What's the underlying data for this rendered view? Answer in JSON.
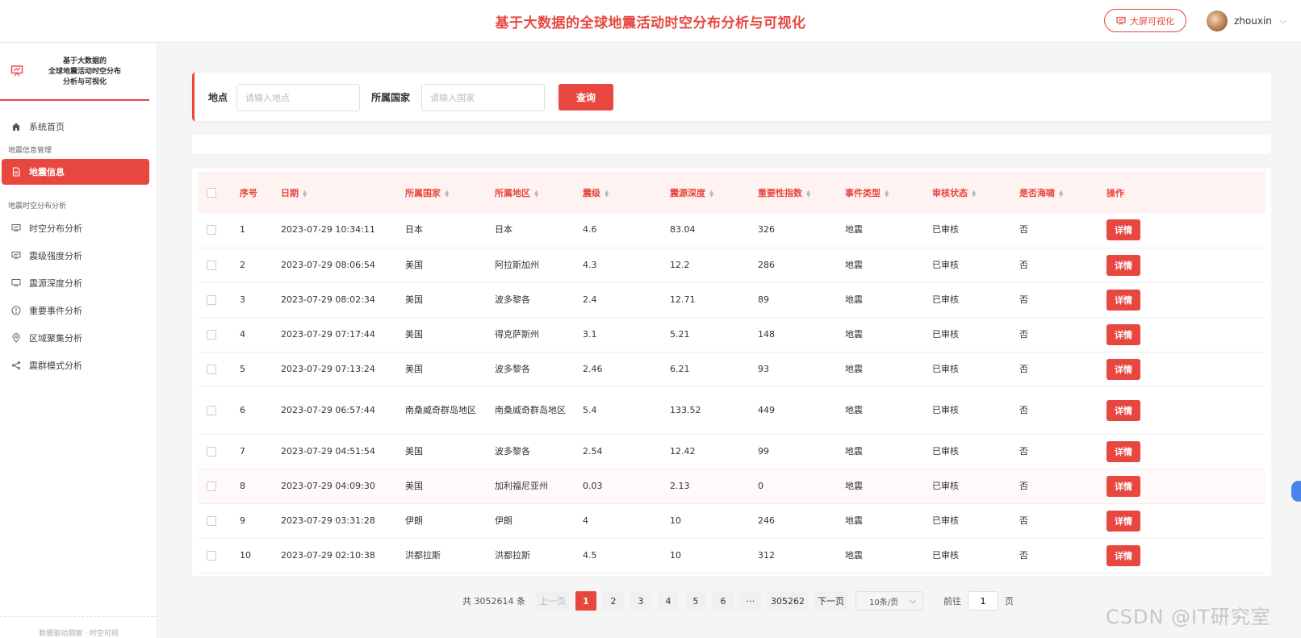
{
  "header": {
    "title": "基于大数据的全球地震活动时空分布分析与可视化",
    "bigscreen_label": "大屏可视化",
    "username": "zhouxin"
  },
  "sidebar": {
    "brand": [
      "基于大数据的",
      "全球地震活动时空分布",
      "分析与可视化"
    ],
    "home_label": "系统首页",
    "group1": "地震信息管理",
    "active_item": "地震信息",
    "group2": "地震时空分布分析",
    "items": [
      {
        "label": "时空分布分析",
        "icon": "chart-icon"
      },
      {
        "label": "震级强度分析",
        "icon": "chart-icon"
      },
      {
        "label": "震源深度分析",
        "icon": "chart-icon"
      },
      {
        "label": "重要事件分析",
        "icon": "alert-circle-icon"
      },
      {
        "label": "区域聚集分析",
        "icon": "location-pin-icon"
      },
      {
        "label": "震群模式分析",
        "icon": "share-icon"
      }
    ],
    "footer": "数据驱动洞察 · 时空可视"
  },
  "search": {
    "place_label": "地点",
    "place_placeholder": "请输入地点",
    "country_label": "所属国家",
    "country_placeholder": "请输入国家",
    "query_label": "查询"
  },
  "table": {
    "columns": [
      "序号",
      "日期",
      "所属国家",
      "所属地区",
      "震级",
      "震源深度",
      "重要性指数",
      "事件类型",
      "审核状态",
      "是否海啸",
      "操作"
    ],
    "detail_label": "详情",
    "rows": [
      {
        "no": "1",
        "date": "2023-07-29 10:34:11",
        "country": "日本",
        "region": "日本",
        "mag": "4.6",
        "depth": "83.04",
        "sig": "326",
        "type": "地震",
        "status": "已审核",
        "tsunami": "否"
      },
      {
        "no": "2",
        "date": "2023-07-29 08:06:54",
        "country": "美国",
        "region": "阿拉斯加州",
        "mag": "4.3",
        "depth": "12.2",
        "sig": "286",
        "type": "地震",
        "status": "已审核",
        "tsunami": "否"
      },
      {
        "no": "3",
        "date": "2023-07-29 08:02:34",
        "country": "美国",
        "region": "波多黎各",
        "mag": "2.4",
        "depth": "12.71",
        "sig": "89",
        "type": "地震",
        "status": "已审核",
        "tsunami": "否"
      },
      {
        "no": "4",
        "date": "2023-07-29 07:17:44",
        "country": "美国",
        "region": "得克萨斯州",
        "mag": "3.1",
        "depth": "5.21",
        "sig": "148",
        "type": "地震",
        "status": "已审核",
        "tsunami": "否"
      },
      {
        "no": "5",
        "date": "2023-07-29 07:13:24",
        "country": "美国",
        "region": "波多黎各",
        "mag": "2.46",
        "depth": "6.21",
        "sig": "93",
        "type": "地震",
        "status": "已审核",
        "tsunami": "否"
      },
      {
        "no": "6",
        "date": "2023-07-29 06:57:44",
        "country": "南桑威奇群岛地区",
        "region": "南桑威奇群岛地区",
        "mag": "5.4",
        "depth": "133.52",
        "sig": "449",
        "type": "地震",
        "status": "已审核",
        "tsunami": "否"
      },
      {
        "no": "7",
        "date": "2023-07-29 04:51:54",
        "country": "美国",
        "region": "波多黎各",
        "mag": "2.54",
        "depth": "12.42",
        "sig": "99",
        "type": "地震",
        "status": "已审核",
        "tsunami": "否"
      },
      {
        "no": "8",
        "date": "2023-07-29 04:09:30",
        "country": "美国",
        "region": "加利福尼亚州",
        "mag": "0.03",
        "depth": "2.13",
        "sig": "0",
        "type": "地震",
        "status": "已审核",
        "tsunami": "否"
      },
      {
        "no": "9",
        "date": "2023-07-29 03:31:28",
        "country": "伊朗",
        "region": "伊朗",
        "mag": "4",
        "depth": "10",
        "sig": "246",
        "type": "地震",
        "status": "已审核",
        "tsunami": "否"
      },
      {
        "no": "10",
        "date": "2023-07-29 02:10:38",
        "country": "洪都拉斯",
        "region": "洪都拉斯",
        "mag": "4.5",
        "depth": "10",
        "sig": "312",
        "type": "地震",
        "status": "已审核",
        "tsunami": "否"
      }
    ]
  },
  "pagination": {
    "total": "共 3052614 条",
    "prev": "上一页",
    "pages": [
      "1",
      "2",
      "3",
      "4",
      "5",
      "6"
    ],
    "ellipsis": "···",
    "last": "305262",
    "next": "下一页",
    "page_size": "10条/页",
    "goto_label": "前往",
    "goto_value": "1",
    "page_suffix": "页"
  },
  "watermark": "CSDN @IT研究室",
  "colors": {
    "accent": "#e8473f",
    "header_bg": "#fef3f1"
  }
}
